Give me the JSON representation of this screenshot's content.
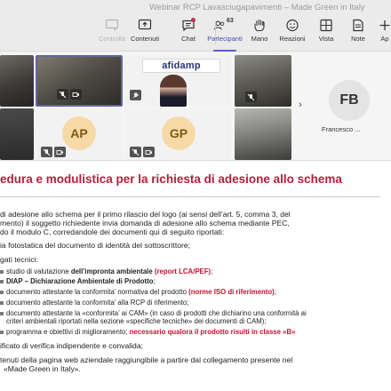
{
  "window": {
    "title": "Webinar RCP Lavasciugapavimenti – Made Green in Italy"
  },
  "toolbar": {
    "controllo": "Controlla",
    "contenuti": "Contenuti",
    "chat": "Chat",
    "partecipanti": "Partecipanti",
    "partecipanti_count": "63",
    "mano": "Mano",
    "reazioni": "Reazioni",
    "vista": "Vista",
    "note": "Note",
    "app": "Ap"
  },
  "gallery": {
    "logo_text": "afidamp",
    "participants": [
      {
        "initials": "AP"
      },
      {
        "initials": "GP"
      },
      {
        "initials": "FB",
        "name": "Francesco ..."
      }
    ]
  },
  "slide": {
    "title": "edura e modulistica per la richiesta di adesione allo schema",
    "lines": [
      "di adesione allo schema per il primo rilascio del logo (ai sensi dell’art. 5, comma 3, del",
      "mento) il soggetto richiedente invia domanda di adesione allo schema mediante PEC,",
      "do il modulo C, corredandole dei documenti qui di seguito riportati:",
      "ia fotostatica del documento di identità del sottoscrittore;",
      "gati tecnici:"
    ],
    "sub": [
      {
        "a": "studio di valutazione ",
        "b": "dell’impronta ambientale ",
        "r": "(report LCA/PEF)",
        "c": ";"
      },
      {
        "a": "",
        "b": "DIAP – Dichiarazione Ambientale di Prodotto",
        "r": "",
        "c": ";"
      },
      {
        "a": "documento attestante la conformita’ normativa del prodotto ",
        "b": "",
        "r": "(norme ISO di riferimento)",
        "c": ";"
      },
      {
        "a": "documento attestante la conformita’ alla RCP di riferimento;",
        "b": "",
        "r": "",
        "c": ""
      },
      {
        "a": "documento attestante la «conformita’ ai CAM» (in caso di prodotti che dichiarino una conformità ai",
        "b": "",
        "r": "",
        "c": ""
      },
      {
        "a": "criteri ambientali riportati nella sezione «specifiche tecniche» dei documenti di CAM);",
        "b": "",
        "r": "",
        "c": ""
      },
      {
        "a": "programma e obiettivi di miglioramento; ",
        "b": "",
        "r": "necessario qualora il prodotto risulti in classe «B»",
        "c": ""
      }
    ],
    "tail": [
      "ificato di verifica indipendente e convalida;",
      "tenuti della pagina web aziendale raggiungibile a partire dal collegamento presente nel",
      "«Made Green in Italy»."
    ]
  }
}
